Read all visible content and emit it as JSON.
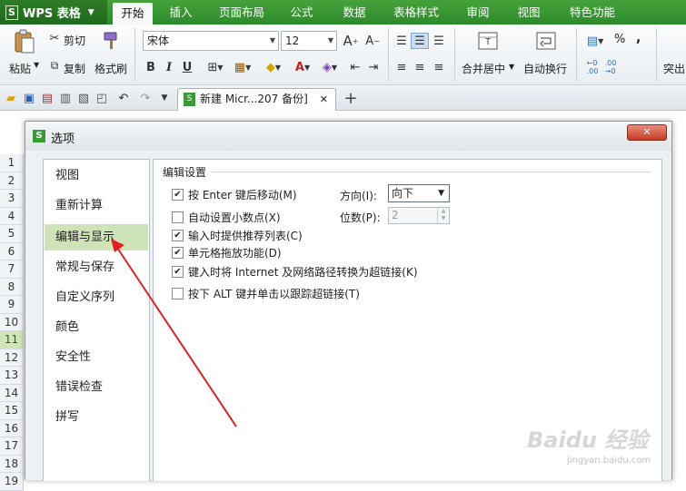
{
  "app": {
    "name": "WPS 表格",
    "logo_letter": "S"
  },
  "menu_tabs": [
    "开始",
    "插入",
    "页面布局",
    "公式",
    "数据",
    "表格样式",
    "审阅",
    "视图",
    "特色功能"
  ],
  "ribbon": {
    "paste": "粘贴",
    "cut": "剪切",
    "copy": "复制",
    "format_painter": "格式刷",
    "font_name": "宋体",
    "font_size": "12",
    "merge_center": "合并居中",
    "wrap_text": "自动换行",
    "percent": "%",
    "comma": ",",
    "partial_label": "突出"
  },
  "doc_tab": {
    "title": "新建 Micr...207 备份]"
  },
  "sheet": {
    "rows": [
      "1",
      "2",
      "3",
      "4",
      "5",
      "6",
      "7",
      "8",
      "9",
      "10",
      "11",
      "12",
      "13",
      "14",
      "15",
      "16",
      "17",
      "18",
      "19"
    ],
    "selected_row": "11"
  },
  "dialog": {
    "title": "选项",
    "sidebar": [
      "视图",
      "重新计算",
      "编辑与显示",
      "常规与保存",
      "自定义序列",
      "颜色",
      "安全性",
      "错误检查",
      "拼写"
    ],
    "selected_index": 2,
    "section_title": "编辑设置",
    "options": [
      {
        "label": "按 Enter 键后移动(M)",
        "checked": true
      },
      {
        "label": "自动设置小数点(X)",
        "checked": false
      },
      {
        "label": "输入时提供推荐列表(C)",
        "checked": true
      },
      {
        "label": "单元格拖放功能(D)",
        "checked": true
      },
      {
        "label": "键入时将 Internet 及网络路径转换为超链接(K)",
        "checked": true
      },
      {
        "label": "按下 ALT 键并单击以跟踪超链接(T)",
        "checked": false
      }
    ],
    "direction_label": "方向(I):",
    "direction_value": "向下",
    "decimal_label": "位数(P):",
    "decimal_value": "2"
  },
  "watermark": {
    "main": "Baidu 经验",
    "sub": "jingyan.baidu.com"
  },
  "colors": {
    "accent_green": "#2d8a2b",
    "selection_green": "#cfe3b8",
    "arrow_red": "#e02020"
  }
}
